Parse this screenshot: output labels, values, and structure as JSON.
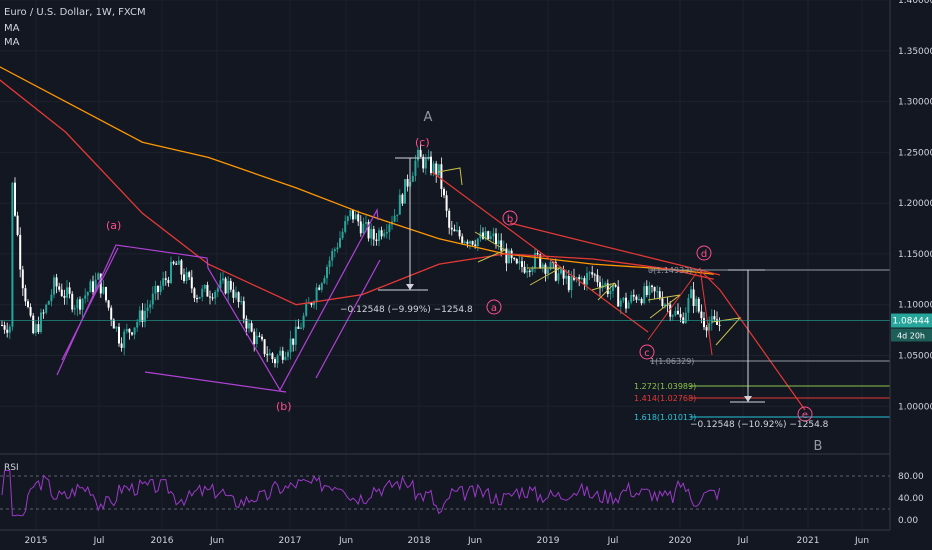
{
  "header": {
    "title": "Euro / U.S. Dollar, 1W, FXCM",
    "ind1": "MA",
    "ind2": "MA"
  },
  "price_tag": {
    "value": "1.08444",
    "countdown": "4d 20h"
  },
  "rsi": {
    "label": "RSI",
    "levels": [
      "80.00",
      "40.00",
      "0.00"
    ]
  },
  "colors": {
    "background": "#131722",
    "up": "#26a69a",
    "ma_short": "#e53935",
    "ma_long": "#ff9800",
    "wave_purple": "#b043d6",
    "wave_label": "#ff4f8b",
    "channel": "#e53935",
    "triangle": "#c9c14a",
    "rsi_line": "#9b3ac8",
    "fib_1272": "#8bc34a",
    "fib_1414": "#e53935",
    "fib_1618": "#26c6da"
  },
  "annotations": {
    "wave_a_upper": "(a)",
    "wave_b_lower": "(b)",
    "wave_c_upper": "(c)",
    "A": "A",
    "B": "B",
    "b_circle": "b",
    "a_circle": "a",
    "d_circle": "d",
    "c_circle": "c",
    "e_circle": "e",
    "measure1": "−0.12548 (−9.99%) −1254.8",
    "measure2": "−0.12548 (−10.92%) −1254.8",
    "fib_top": "0(1.14933)",
    "fib_base": "1(1.06329)",
    "fib_1272": "1.272(1.03989)",
    "fib_1414": "1.414(1.02768)",
    "fib_1618": "1.618(1.01013)"
  },
  "chart_data": {
    "type": "candlestick",
    "title": "Euro / U.S. Dollar, 1W, FXCM",
    "ylim": [
      0.955,
      1.4
    ],
    "y_ticks": [
      "1.40000",
      "1.35000",
      "1.30000",
      "1.25000",
      "1.20000",
      "1.15000",
      "1.10000",
      "1.05000",
      "1.00000"
    ],
    "x_ticks": [
      "2015",
      "Jul",
      "2016",
      "Jun",
      "2017",
      "Jun",
      "2018",
      "Jun",
      "2019",
      "Jul",
      "2020",
      "Jul",
      "2021",
      "Jun"
    ],
    "price_path": [
      [
        "2015-01",
        1.235
      ],
      [
        "2015-02",
        1.13
      ],
      [
        "2015-03",
        1.07
      ],
      [
        "2015-04",
        1.09
      ],
      [
        "2015-05",
        1.12
      ],
      [
        "2015-07",
        1.1
      ],
      [
        "2015-09",
        1.125
      ],
      [
        "2015-11",
        1.065
      ],
      [
        "2016-01",
        1.09
      ],
      [
        "2016-04",
        1.14
      ],
      [
        "2016-06",
        1.11
      ],
      [
        "2016-09",
        1.12
      ],
      [
        "2016-11",
        1.07
      ],
      [
        "2017-01",
        1.045
      ],
      [
        "2017-03",
        1.07
      ],
      [
        "2017-05",
        1.12
      ],
      [
        "2017-08",
        1.19
      ],
      [
        "2017-10",
        1.165
      ],
      [
        "2017-12",
        1.19
      ],
      [
        "2018-02",
        1.245
      ],
      [
        "2018-04",
        1.23
      ],
      [
        "2018-05",
        1.17
      ],
      [
        "2018-07",
        1.165
      ],
      [
        "2018-09",
        1.165
      ],
      [
        "2018-11",
        1.135
      ],
      [
        "2019-01",
        1.145
      ],
      [
        "2019-04",
        1.12
      ],
      [
        "2019-06",
        1.13
      ],
      [
        "2019-09",
        1.1
      ],
      [
        "2019-10",
        1.11
      ],
      [
        "2019-12",
        1.11
      ],
      [
        "2020-02",
        1.085
      ],
      [
        "2020-03",
        1.11
      ],
      [
        "2020-04",
        1.085
      ],
      [
        "2020-05",
        1.08
      ]
    ],
    "ma_short": [
      [
        "2014-11",
        1.33
      ],
      [
        "2015-06",
        1.27
      ],
      [
        "2016-01",
        1.19
      ],
      [
        "2016-07",
        1.14
      ],
      [
        "2017-03",
        1.1
      ],
      [
        "2017-09",
        1.11
      ],
      [
        "2018-04",
        1.14
      ],
      [
        "2018-10",
        1.15
      ],
      [
        "2019-06",
        1.145
      ],
      [
        "2020-01",
        1.135
      ],
      [
        "2020-05",
        1.125
      ]
    ],
    "ma_long": [
      [
        "2014-11",
        1.34
      ],
      [
        "2015-06",
        1.3
      ],
      [
        "2016-01",
        1.26
      ],
      [
        "2016-07",
        1.245
      ],
      [
        "2017-03",
        1.215
      ],
      [
        "2017-09",
        1.19
      ],
      [
        "2018-04",
        1.165
      ],
      [
        "2018-10",
        1.15
      ],
      [
        "2019-06",
        1.14
      ],
      [
        "2020-01",
        1.135
      ],
      [
        "2020-05",
        1.13
      ]
    ],
    "fib_levels": {
      "0": 1.14933,
      "1": 1.06329,
      "1.272": 1.03989,
      "1.414": 1.02768,
      "1.618": 1.01013
    },
    "current_price": 1.08444,
    "rsi_range": [
      0,
      100
    ]
  }
}
